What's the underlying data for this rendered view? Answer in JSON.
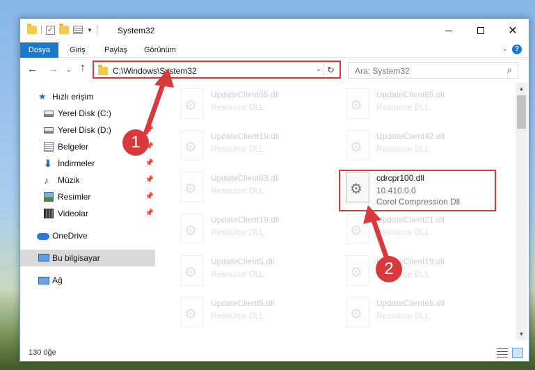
{
  "window": {
    "title": "System32"
  },
  "ribbon": {
    "tabs": [
      "Dosya",
      "Giriş",
      "Paylaş",
      "Görünüm"
    ]
  },
  "navbar": {
    "address": "C:\\Windows\\System32",
    "search_placeholder": "Ara: System32"
  },
  "sidebar": {
    "items": [
      {
        "label": "Hızlı erişim",
        "icon": "star-icon"
      },
      {
        "label": "Yerel Disk (C:)",
        "icon": "disk-icon"
      },
      {
        "label": "Yerel Disk (D:)",
        "icon": "disk-icon"
      },
      {
        "label": "Belgeler",
        "icon": "documents-icon"
      },
      {
        "label": "İndirmeler",
        "icon": "download-icon"
      },
      {
        "label": "Müzik",
        "icon": "music-icon"
      },
      {
        "label": "Resimler",
        "icon": "pictures-icon"
      },
      {
        "label": "Videolar",
        "icon": "video-icon"
      },
      {
        "label": "OneDrive",
        "icon": "cloud-icon"
      },
      {
        "label": "Bu bilgisayar",
        "icon": "computer-icon"
      },
      {
        "label": "Ağ",
        "icon": "network-icon"
      }
    ]
  },
  "files": [
    {
      "name": "UpdateClient65.dll",
      "line2": "Resource DLL"
    },
    {
      "name": "UpdateClient65.dll",
      "line2": "Resource DLL"
    },
    {
      "name": "UpdateClient19.dll",
      "line2": "Resource DLL"
    },
    {
      "name": "UpdateClient42.dll",
      "line2": "Resource DLL"
    },
    {
      "name": "UpdateClient63.dll",
      "line2": "Resource DLL"
    },
    {
      "name": "cdrcpr100.dll",
      "line2": "10.410.0.0",
      "line3": "Corel Compression Dll"
    },
    {
      "name": "UpdateClient19.dll",
      "line2": "Resource DLL"
    },
    {
      "name": "UpdateClient21.dll",
      "line2": "Resource DLL"
    },
    {
      "name": "UpdateClient5.dll",
      "line2": "Resource DLL"
    },
    {
      "name": "UpdateClient19.dll",
      "line2": "Resource DLL"
    },
    {
      "name": "UpdateClient5.dll",
      "line2": "Resource DLL"
    },
    {
      "name": "UpdateClient65.dll",
      "line2": "Resource DLL"
    }
  ],
  "status": {
    "item_count": "130 öğe"
  },
  "callouts": [
    "1",
    "2"
  ],
  "colors": {
    "accent": "#1979ca",
    "highlight": "#d9393d"
  }
}
